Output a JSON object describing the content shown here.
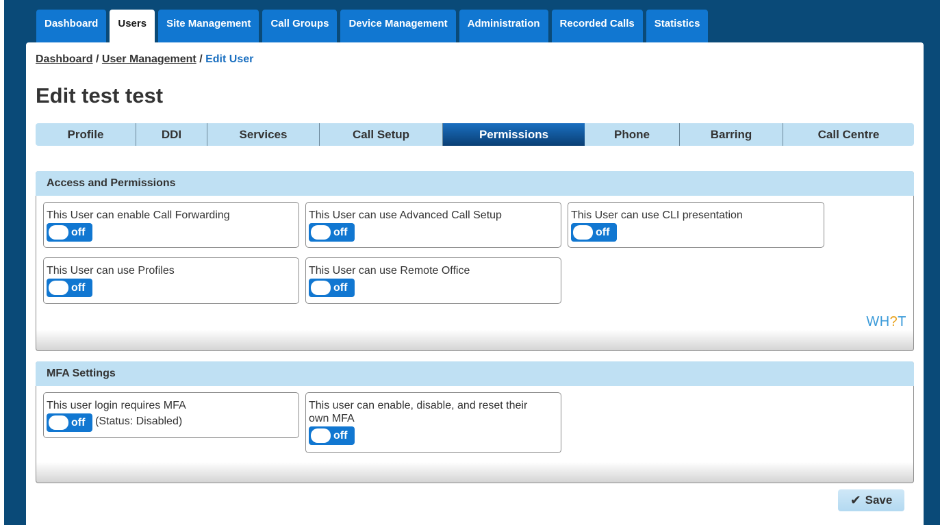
{
  "nav": {
    "tabs": [
      {
        "label": "Dashboard",
        "active": false
      },
      {
        "label": "Users",
        "active": true
      },
      {
        "label": "Site Management",
        "active": false
      },
      {
        "label": "Call Groups",
        "active": false
      },
      {
        "label": "Device Management",
        "active": false
      },
      {
        "label": "Administration",
        "active": false
      },
      {
        "label": "Recorded Calls",
        "active": false
      },
      {
        "label": "Statistics",
        "active": false
      }
    ]
  },
  "breadcrumb": {
    "items": [
      "Dashboard",
      "User Management"
    ],
    "separator": "/",
    "current": "Edit User"
  },
  "page_title": "Edit test test",
  "subtabs": [
    {
      "label": "Profile",
      "active": false
    },
    {
      "label": "DDI",
      "active": false
    },
    {
      "label": "Services",
      "active": false
    },
    {
      "label": "Call Setup",
      "active": false
    },
    {
      "label": "Permissions",
      "active": true
    },
    {
      "label": "Phone",
      "active": false
    },
    {
      "label": "Barring",
      "active": false
    },
    {
      "label": "Call Centre",
      "active": false
    }
  ],
  "access": {
    "title": "Access and Permissions",
    "items": [
      {
        "label": "This User can enable Call Forwarding",
        "toggle": "off"
      },
      {
        "label": "This User can use Advanced Call Setup",
        "toggle": "off"
      },
      {
        "label": "This User can use CLI presentation",
        "toggle": "off"
      },
      {
        "label": "This User can use Profiles",
        "toggle": "off"
      },
      {
        "label": "This User can use Remote Office",
        "toggle": "off"
      }
    ]
  },
  "logo": {
    "part1": "WH",
    "part2": "?",
    "part3": "T"
  },
  "mfa": {
    "title": "MFA Settings",
    "items": [
      {
        "label": "This user login requires MFA",
        "toggle": "off",
        "status": "(Status: Disabled)"
      },
      {
        "label": "This user can enable, disable, and reset their own MFA",
        "toggle": "off"
      }
    ]
  },
  "save_label": "Save",
  "colors": {
    "frame": "#0a4a78",
    "tab_blue": "#1177d1",
    "header_light": "#bfe0f3",
    "active_subtab": "#0a3f74"
  }
}
